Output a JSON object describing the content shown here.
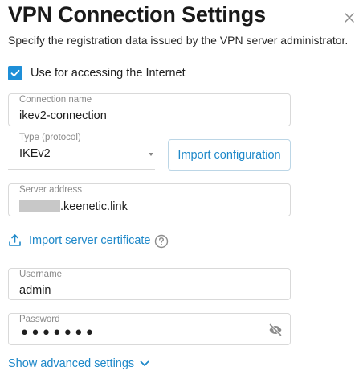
{
  "dialog": {
    "title": "VPN Connection Settings",
    "subtitle": "Specify the registration data issued by the VPN server administrator."
  },
  "use_internet": {
    "label": "Use for accessing the Internet",
    "checked": true
  },
  "connection_name": {
    "label": "Connection name",
    "value": "ikev2-connection"
  },
  "type": {
    "label": "Type (protocol)",
    "value": "IKEv2"
  },
  "import_config": {
    "label": "Import configuration"
  },
  "server_address": {
    "label": "Server address",
    "value_suffix": ".keenetic.link"
  },
  "import_cert": {
    "label": "Import server certificate"
  },
  "username": {
    "label": "Username",
    "value": "admin"
  },
  "password": {
    "label": "Password",
    "masked_value": "•••••••"
  },
  "advanced": {
    "label": "Show advanced settings"
  },
  "colors": {
    "accent": "#1e8fd8",
    "link": "#1e88c9",
    "border": "#d9d9d9"
  }
}
